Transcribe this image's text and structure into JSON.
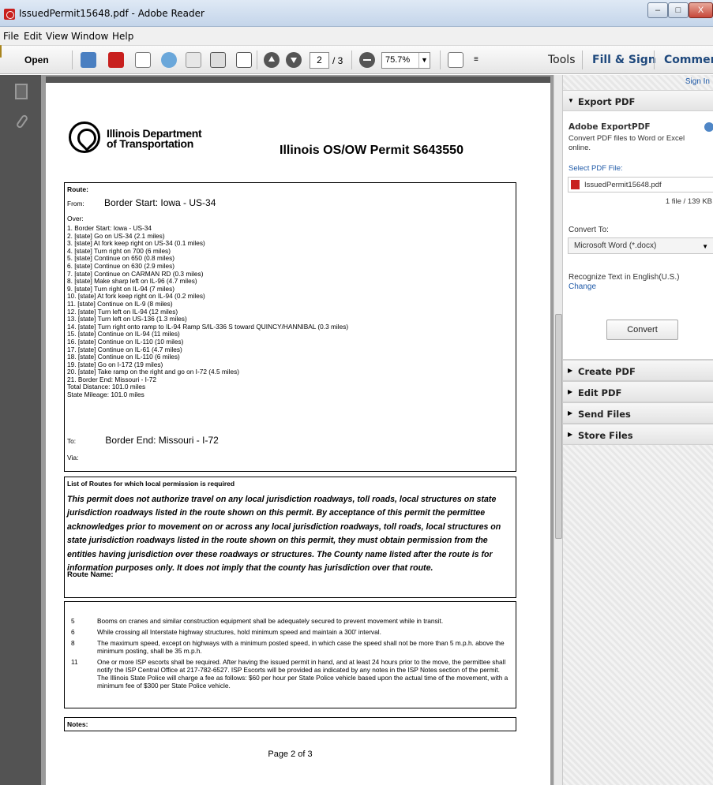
{
  "window": {
    "title": "IssuedPermit15648.pdf - Adobe Reader",
    "minimize": "–",
    "maximize": "□",
    "close": "X"
  },
  "menu": [
    "File",
    "Edit",
    "View",
    "Window",
    "Help"
  ],
  "toolbar": {
    "open_label": "Open",
    "page_current": "2",
    "page_total": "/ 3",
    "zoom": "75.7%",
    "more": "≡",
    "tabs": [
      "Tools",
      "Fill & Sign",
      "Comment"
    ]
  },
  "document": {
    "agency": "Illinois Department\nof Transportation",
    "permit_title": "Illinois OS/OW Permit S643550",
    "route": {
      "label": "Route:",
      "from_label": "From:",
      "from_value": "Border Start: Iowa - US-34",
      "over_label": "Over:",
      "steps": [
        "1. Border Start: Iowa - US-34",
        "2. [state] Go on US-34   (2.1 miles)",
        "3. [state] At fork keep right on US-34   (0.1 miles)",
        "4. [state] Turn right on 700   (6 miles)",
        "5. [state] Continue on 650   (0.8 miles)",
        "6. [state] Continue on 630   (2.9 miles)",
        "7. [state] Continue on CARMAN RD   (0.3 miles)",
        "8. [state] Make sharp left on IL-96   (4.7 miles)",
        "9. [state] Turn right on IL-94   (7 miles)",
        "10. [state] At fork keep right on IL-94   (0.2 miles)",
        "11. [state] Continue on IL-9   (8 miles)",
        "12. [state] Turn left on IL-94   (12 miles)",
        "13. [state] Turn left on US-136   (1.3 miles)",
        "14. [state] Turn right onto ramp to IL-94 Ramp S/IL-336 S toward QUINCY/HANNIBAL   (0.3 miles)",
        "15. [state] Continue on IL-94   (11 miles)",
        "16. [state] Continue on IL-110   (10 miles)",
        "17. [state] Continue on IL-61   (4.7 miles)",
        "18. [state] Continue on IL-110   (6 miles)",
        "19. [state] Go on I-172   (19 miles)",
        "20. [state] Take ramp on the right and go on I-72   (4.5 miles)",
        "21. Border End: Missouri - I-72",
        "Total Distance: 101.0 miles",
        "State Mileage: 101.0 miles"
      ],
      "to_label": "To:",
      "to_value": "Border End: Missouri - I-72",
      "via_label": "Via:"
    },
    "local_permission": {
      "title": "List of Routes for which local permission is required",
      "text": "This permit does not authorize travel on any local jurisdiction roadways, toll roads, local structures on state jurisdiction roadways listed in the route shown on this permit.  By acceptance of this permit the permittee acknowledges prior to movement on or across any local jurisdiction roadways, toll roads, local structures on state jurisdiction roadways listed in the route shown on this permit, they must obtain permission from the entities having jurisdiction over these roadways or structures.  The County name listed after the route is for information purposes only. It does not imply that the county has jurisdiction over that route.",
      "route_name_label": "Route Name:"
    },
    "conditions": [
      {
        "num": "5",
        "text": "Booms on cranes and similar construction equipment shall be adequately secured to prevent movement while in transit."
      },
      {
        "num": "6",
        "text": "While crossing all Interstate highway structures, hold minimum speed and maintain a 300' interval."
      },
      {
        "num": "8",
        "text": "The maximum speed, except on highways with a minimum posted speed, in which case the speed shall not be more than 5 m.p.h. above the minimum posting, shall be 35 m.p.h."
      },
      {
        "num": "11",
        "text": "One or more ISP escorts shall be required. After having the issued permit in hand, and at least 24 hours prior to the move, the permittee shall notify the ISP Central Office at 217-782-6527. ISP Escorts will be provided as indicated by any notes in the ISP Notes section of the permit. The Illinois State Police will charge a fee as follows: $60 per hour per State Police vehicle based upon the actual time of the movement, with a minimum fee of $300 per State Police vehicle."
      }
    ],
    "notes_label": "Notes:",
    "page_footer": "Page 2 of 3"
  },
  "right_pane": {
    "sign_in": "Sign In",
    "export_pdf": {
      "header": "Export PDF",
      "title": "Adobe ExportPDF",
      "description": "Convert PDF files to Word or Excel online.",
      "select_label": "Select PDF File:",
      "file_name": "IssuedPermit15648.pdf",
      "file_count": "1 file / 139 KB",
      "convert_to_label": "Convert To:",
      "convert_to_value": "Microsoft Word (*.docx)",
      "ocr_text": "Recognize Text in English(U.S.)",
      "change_link": "Change",
      "convert_button": "Convert"
    },
    "sections": [
      "Create PDF",
      "Edit PDF",
      "Send Files",
      "Store Files"
    ]
  },
  "colors": {
    "title_bar": "#c4d5ea",
    "pdf_red": "#c8201e",
    "link_blue": "#1f5aa8",
    "nav_dark": "#535353"
  },
  "icons": [
    "pdf-icon",
    "folder-open-icon",
    "create-icon",
    "pdf-convert-icon",
    "edit-icon",
    "cloud-upload-icon",
    "save-icon",
    "print-icon",
    "email-icon",
    "page-up-icon",
    "page-down-icon",
    "zoom-out-icon",
    "fullscreen-icon",
    "pages-icon",
    "attachment-icon",
    "help-icon"
  ]
}
